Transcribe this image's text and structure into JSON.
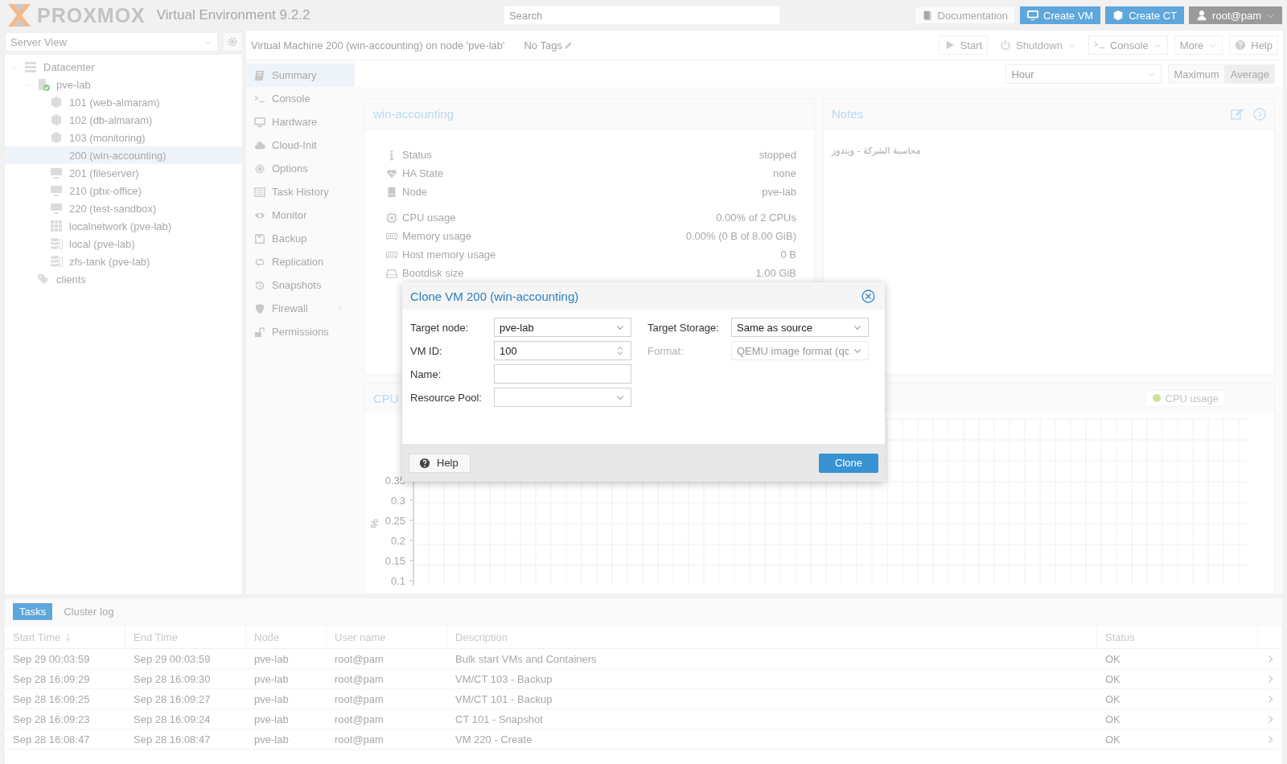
{
  "header": {
    "logo": "PROXMOX",
    "product": "Virtual Environment 9.2.2",
    "search": {
      "placeholder": "Search"
    },
    "buttons": [
      {
        "label": "Documentation",
        "kind": "doc"
      },
      {
        "label": "Create VM",
        "kind": "create-vm"
      },
      {
        "label": "Create CT",
        "kind": "create-ct"
      }
    ],
    "user": "root@pam"
  },
  "tree": {
    "view": "Server View",
    "items": [
      {
        "label": "Datacenter",
        "kind": "datacenter",
        "selected": false,
        "expanded": true,
        "children": [
          {
            "label": "pve-lab",
            "kind": "node",
            "selected": false,
            "expanded": true,
            "children": [
              {
                "label": "101 (web-almaram)",
                "kind": "ct",
                "selected": false
              },
              {
                "label": "102 (db-almaram)",
                "kind": "ct",
                "selected": false
              },
              {
                "label": "103 (monitoring)",
                "kind": "ct",
                "selected": false
              },
              {
                "label": "200 (win-accounting)",
                "kind": "template",
                "selected": true
              },
              {
                "label": "201 (fileserver)",
                "kind": "vm",
                "selected": false
              },
              {
                "label": "210 (pbx-office)",
                "kind": "vm",
                "selected": false
              },
              {
                "label": "220 (test-sandbox)",
                "kind": "vm",
                "selected": false
              },
              {
                "label": "localnetwork (pve-lab)",
                "kind": "network",
                "selected": false
              },
              {
                "label": "local (pve-lab)",
                "kind": "storage",
                "selected": false
              },
              {
                "label": "zfs-tank (pve-lab)",
                "kind": "storage",
                "selected": false
              }
            ]
          },
          {
            "label": "clients",
            "kind": "pool",
            "selected": false
          }
        ]
      }
    ]
  },
  "vm_header": {
    "title": "Virtual Machine 200 (win-accounting) on node 'pve-lab'",
    "tags": "No Tags"
  },
  "toolbar": [
    {
      "label": "Start",
      "kind": "start",
      "disabled": false,
      "dropdown": false
    },
    {
      "label": "Shutdown",
      "kind": "power",
      "disabled": true,
      "dropdown": true
    },
    {
      "label": "Console",
      "kind": "console",
      "disabled": false,
      "dropdown": true
    },
    {
      "label": "More",
      "kind": "none",
      "disabled": false,
      "dropdown": true
    },
    {
      "label": "Help",
      "kind": "help",
      "disabled": false,
      "dropdown": false
    }
  ],
  "nav": [
    {
      "label": "Summary",
      "kind": "book",
      "selected": true,
      "submenu": false
    },
    {
      "label": "Console",
      "kind": "console",
      "selected": false,
      "submenu": false
    },
    {
      "label": "Hardware",
      "kind": "monitor",
      "selected": false,
      "submenu": false
    },
    {
      "label": "Cloud-Init",
      "kind": "cloud",
      "selected": false,
      "submenu": false
    },
    {
      "label": "Options",
      "kind": "gear",
      "selected": false,
      "submenu": false
    },
    {
      "label": "Task History",
      "kind": "list",
      "selected": false,
      "submenu": false
    },
    {
      "label": "Monitor",
      "kind": "eye",
      "selected": false,
      "submenu": false
    },
    {
      "label": "Backup",
      "kind": "disk",
      "selected": false,
      "submenu": false
    },
    {
      "label": "Replication",
      "kind": "retweet",
      "selected": false,
      "submenu": false
    },
    {
      "label": "Snapshots",
      "kind": "history",
      "selected": false,
      "submenu": false
    },
    {
      "label": "Firewall",
      "kind": "shield",
      "selected": false,
      "submenu": true
    },
    {
      "label": "Permissions",
      "kind": "unlock",
      "selected": false,
      "submenu": false
    }
  ],
  "timeframe": {
    "value": "Hour",
    "modes": [
      {
        "label": "Maximum",
        "selected": false
      },
      {
        "label": "Average",
        "selected": true
      }
    ]
  },
  "status_panel": {
    "title": "win-accounting",
    "groups": [
      [
        {
          "kind": "info",
          "label": "Status",
          "value": "stopped"
        },
        {
          "kind": "heart",
          "label": "HA State",
          "value": "none"
        },
        {
          "kind": "server",
          "label": "Node",
          "value": "pve-lab"
        }
      ],
      [
        {
          "kind": "chip",
          "label": "CPU usage",
          "value": "0.00% of 2 CPUs"
        },
        {
          "kind": "memory",
          "label": "Memory usage",
          "value": "0.00% (0 B of 8.00 GiB)"
        },
        {
          "kind": "memory",
          "label": "Host memory usage",
          "value": "0 B"
        },
        {
          "kind": "hdd",
          "label": "Bootdisk size",
          "value": "1.00 GiB"
        }
      ]
    ]
  },
  "notes": {
    "title": "Notes",
    "text": "محاسبة الشركة - ويندوز"
  },
  "cpu_chart": {
    "title": "CPU",
    "legend": {
      "label": "CPU usage",
      "color": "#cfe29a"
    },
    "unit": "%",
    "yticks": [
      "0.35",
      "0.3",
      "0.25",
      "0.2",
      "0.15",
      "0.1"
    ]
  },
  "tasks": {
    "tabs": [
      {
        "label": "Tasks",
        "selected": true
      },
      {
        "label": "Cluster log",
        "selected": false
      }
    ],
    "columns": [
      {
        "label": "Start Time",
        "sorted": true
      },
      {
        "label": "End Time",
        "sorted": false
      },
      {
        "label": "Node",
        "sorted": false
      },
      {
        "label": "User name",
        "sorted": false
      },
      {
        "label": "Description",
        "sorted": false
      },
      {
        "label": "Status",
        "sorted": false
      }
    ],
    "rows": [
      [
        "Sep 29 00:03:59",
        "Sep 29 00:03:59",
        "pve-lab",
        "root@pam",
        "Bulk start VMs and Containers",
        "OK"
      ],
      [
        "Sep 28 16:09:29",
        "Sep 28 16:09:30",
        "pve-lab",
        "root@pam",
        "VM/CT 103 - Backup",
        "OK"
      ],
      [
        "Sep 28 16:09:25",
        "Sep 28 16:09:27",
        "pve-lab",
        "root@pam",
        "VM/CT 101 - Backup",
        "OK"
      ],
      [
        "Sep 28 16:09:23",
        "Sep 28 16:09:24",
        "pve-lab",
        "root@pam",
        "CT 101 - Snapshot",
        "OK"
      ],
      [
        "Sep 28 16:08:47",
        "Sep 28 16:08:47",
        "pve-lab",
        "root@pam",
        "VM 220 - Create",
        "OK"
      ]
    ]
  },
  "dialog": {
    "title": "Clone VM 200 (win-accounting)",
    "left_fields": [
      {
        "label": "Target node:",
        "kind": "combo",
        "value": "pve-lab",
        "disabled": false
      },
      {
        "label": "VM ID:",
        "kind": "spin",
        "value": "100",
        "disabled": false
      },
      {
        "label": "Name:",
        "kind": "text",
        "disabled": false
      },
      {
        "label": "Resource Pool:",
        "kind": "combo",
        "disabled": false
      }
    ],
    "right_fields": [
      {
        "label": "Target Storage:",
        "kind": "combo",
        "value": "Same as source",
        "disabled": false
      },
      {
        "label": "Format:",
        "kind": "combo",
        "value": "QEMU image format (qc",
        "disabled": true
      }
    ],
    "help": "Help",
    "submit": "Clone"
  }
}
